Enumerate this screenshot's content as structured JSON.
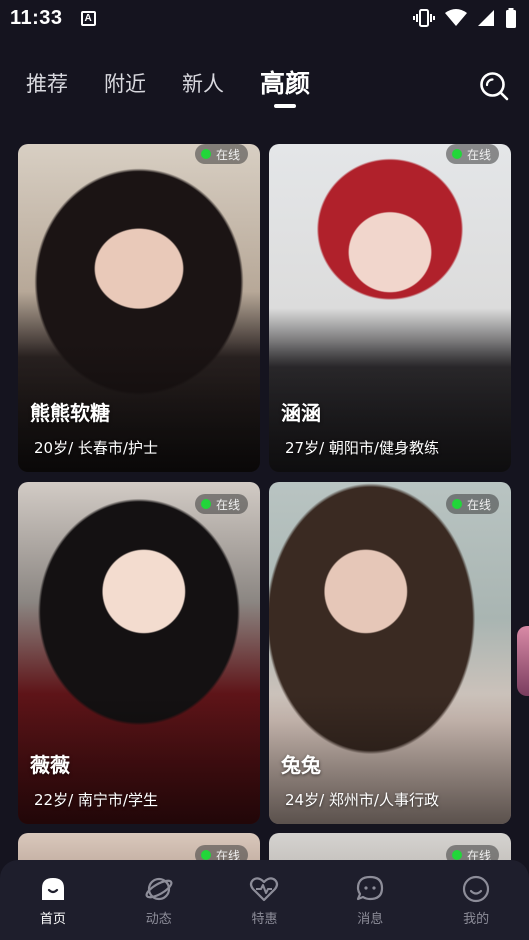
{
  "status_bar": {
    "time": "11:33",
    "a_label": "A"
  },
  "tabs": [
    {
      "label": "推荐",
      "active": false
    },
    {
      "label": "附近",
      "active": false
    },
    {
      "label": "新人",
      "active": false
    },
    {
      "label": "高颜",
      "active": true
    }
  ],
  "cards": [
    {
      "online": "在线",
      "name": "熊熊软糖",
      "info": "20岁/ 长春市/护士"
    },
    {
      "online": "在线",
      "name": "涵涵",
      "info": "27岁/ 朝阳市/健身教练"
    },
    {
      "online": "在线",
      "name": "薇薇",
      "info": "22岁/ 南宁市/学生"
    },
    {
      "online": "在线",
      "name": "兔兔",
      "info": "24岁/ 郑州市/人事行政"
    },
    {
      "online": "在线",
      "name": "",
      "info": ""
    },
    {
      "online": "在线",
      "name": "",
      "info": ""
    }
  ],
  "nav": [
    {
      "label": "首页",
      "icon": "home-icon",
      "active": true
    },
    {
      "label": "动态",
      "icon": "planet-icon",
      "active": false
    },
    {
      "label": "特惠",
      "icon": "heart-pulse-icon",
      "active": false
    },
    {
      "label": "消息",
      "icon": "chat-bubble-icon",
      "active": false
    },
    {
      "label": "我的",
      "icon": "profile-smile-icon",
      "active": false
    }
  ],
  "colors": {
    "background": "#15141f",
    "nav_background": "#1e1e2c",
    "online_dot": "#22d63a"
  }
}
